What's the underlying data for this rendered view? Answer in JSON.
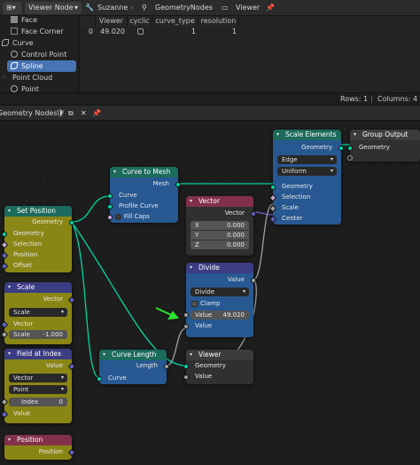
{
  "topbar": {
    "viewer_node_label": "Viewer Node",
    "breadcrumb_object": "Suzanne",
    "breadcrumb_tree": "GeometryNodes",
    "breadcrumb_viewer": "Viewer"
  },
  "tree": [
    {
      "label": "Face",
      "indent": 1
    },
    {
      "label": "Face Corner",
      "indent": 1
    },
    {
      "label": "Curve",
      "indent": 0
    },
    {
      "label": "Control Point",
      "indent": 1
    },
    {
      "label": "Spline",
      "indent": 1,
      "active": true
    },
    {
      "label": "Point Cloud",
      "indent": 0
    },
    {
      "label": "Point",
      "indent": 1
    }
  ],
  "spreadsheet": {
    "columns": [
      "Viewer",
      "cyclic",
      "curve_type",
      "resolution"
    ],
    "row": {
      "index": "0",
      "viewer": "49.020",
      "curve_type": "1",
      "resolution": "1"
    },
    "status_rows": "Rows: 1",
    "status_columns": "Columns: 4"
  },
  "node_editor": {
    "title": "Geometry Nodes"
  },
  "nodes": {
    "scale_elements": {
      "title": "Scale Elements",
      "out_geometry": "Geometry",
      "domain": "Edge",
      "mode": "Uniform",
      "in_geometry": "Geometry",
      "in_selection": "Selection",
      "in_scale": "Scale",
      "in_center": "Center"
    },
    "group_output": {
      "title": "Group Output",
      "in_geometry": "Geometry"
    },
    "curve_to_mesh": {
      "title": "Curve to Mesh",
      "out_mesh": "Mesh",
      "in_curve": "Curve",
      "in_profile": "Profile Curve",
      "fill_caps": "Fill Caps"
    },
    "vector": {
      "title": "Vector",
      "out_vector": "Vector",
      "x_label": "X",
      "x_value": "0.000",
      "y_label": "Y",
      "y_value": "0.000",
      "z_label": "Z",
      "z_value": "0.000"
    },
    "set_position": {
      "title": "Set Position",
      "out_geometry": "Geometry",
      "in_geometry": "Geometry",
      "in_selection": "Selection",
      "in_position": "Position",
      "in_offset": "Offset"
    },
    "divide": {
      "title": "Divide",
      "out_value": "Value",
      "operation": "Divide",
      "clamp": "Clamp",
      "value_label": "Value",
      "value": "49.020",
      "in_value": "Value"
    },
    "scale": {
      "title": "Scale",
      "out_vector": "Vector",
      "operation": "Scale",
      "in_vector": "Vector",
      "scale_label": "Scale",
      "scale_value": "-1.000"
    },
    "field_at_index": {
      "title": "Field at Index",
      "out_value": "Value",
      "type": "Vector",
      "domain": "Point",
      "index_label": "Index",
      "index_value": "0",
      "in_value": "Value"
    },
    "curve_length": {
      "title": "Curve Length",
      "out_length": "Length",
      "in_curve": "Curve"
    },
    "viewer": {
      "title": "Viewer",
      "in_geometry": "Geometry",
      "in_value": "Value"
    },
    "position": {
      "title": "Position",
      "out_position": "Position"
    }
  },
  "colors": {
    "geometry_socket": "#00d6a3",
    "vector_socket": "#6363c7",
    "float_socket": "#a1a1a1",
    "active_highlight": "#4772b3",
    "annotation_arrow": "#2ee62e"
  }
}
